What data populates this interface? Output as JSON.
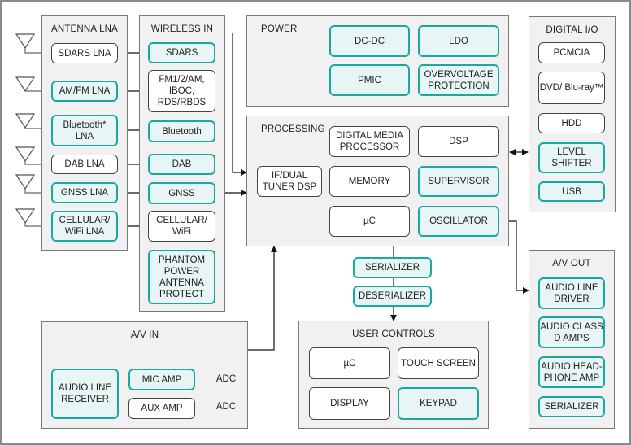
{
  "colors": {
    "highlight_border": "#17aaa2",
    "highlight_fill": "#e7f5f4",
    "panel_fill": "#f1f1f1"
  },
  "panels": {
    "antenna_lna": {
      "title": "ANTENNA LNA",
      "blocks": [
        {
          "label": "SDARS LNA",
          "highlight": false
        },
        {
          "label": "AM/FM LNA",
          "highlight": true
        },
        {
          "label": "Bluetooth* LNA",
          "highlight": true
        },
        {
          "label": "DAB LNA",
          "highlight": false
        },
        {
          "label": "GNSS LNA",
          "highlight": true
        },
        {
          "label": "CELLULAR/ WiFi LNA",
          "highlight": true
        }
      ]
    },
    "wireless_in": {
      "title": "WIRELESS IN",
      "blocks": [
        {
          "label": "SDARS",
          "highlight": true
        },
        {
          "label": "FM1/2/AM, IBOC, RDS/RBDS",
          "highlight": false
        },
        {
          "label": "Bluetooth",
          "highlight": true
        },
        {
          "label": "DAB",
          "highlight": true
        },
        {
          "label": "GNSS",
          "highlight": true
        },
        {
          "label": "CELLULAR/ WiFi",
          "highlight": false
        },
        {
          "label": "PHANTOM POWER ANTENNA PROTECT",
          "highlight": true
        }
      ]
    },
    "power": {
      "title": "POWER",
      "blocks": [
        {
          "label": "DC-DC",
          "highlight": true
        },
        {
          "label": "LDO",
          "highlight": true
        },
        {
          "label": "PMIC",
          "highlight": true
        },
        {
          "label": "OVERVOLTAGE PROTECTION",
          "highlight": true
        }
      ]
    },
    "processing": {
      "title": "PROCESSING",
      "blocks": [
        {
          "label": "DIGITAL MEDIA PROCESSOR",
          "highlight": false
        },
        {
          "label": "DSP",
          "highlight": false
        },
        {
          "label": "IF/DUAL TUNER DSP",
          "highlight": false
        },
        {
          "label": "MEMORY",
          "highlight": false
        },
        {
          "label": "SUPERVISOR",
          "highlight": true
        },
        {
          "label": "µC",
          "highlight": false
        },
        {
          "label": "OSCILLATOR",
          "highlight": true
        }
      ]
    },
    "link": {
      "blocks": [
        {
          "label": "SERIALIZER",
          "highlight": true
        },
        {
          "label": "DESERIALIZER",
          "highlight": true
        }
      ]
    },
    "user_controls": {
      "title": "USER CONTROLS",
      "blocks": [
        {
          "label": "µC",
          "highlight": false
        },
        {
          "label": "TOUCH SCREEN",
          "highlight": false
        },
        {
          "label": "DISPLAY",
          "highlight": false
        },
        {
          "label": "KEYPAD",
          "highlight": true
        }
      ]
    },
    "digital_io": {
      "title": "DIGITAL I/O",
      "blocks": [
        {
          "label": "PCMCIA",
          "highlight": false
        },
        {
          "label": "DVD/ Blu-ray™",
          "highlight": false
        },
        {
          "label": "HDD",
          "highlight": false
        },
        {
          "label": "LEVEL SHIFTER",
          "highlight": true
        },
        {
          "label": "USB",
          "highlight": true
        }
      ]
    },
    "av_out": {
      "title": "A/V OUT",
      "blocks": [
        {
          "label": "AUDIO LINE DRIVER",
          "highlight": true
        },
        {
          "label": "AUDIO CLASS D AMPS",
          "highlight": true
        },
        {
          "label": "AUDIO HEAD-PHONE AMP",
          "highlight": true
        },
        {
          "label": "SERIALIZER",
          "highlight": true
        }
      ]
    },
    "av_in": {
      "title": "A/V IN",
      "blocks": [
        {
          "label": "AUDIO LINE RECEIVER",
          "highlight": true
        },
        {
          "label": "MIC AMP",
          "highlight": true
        },
        {
          "label": "AUX AMP",
          "highlight": false
        }
      ],
      "adc": [
        "ADC",
        "ADC"
      ]
    }
  }
}
